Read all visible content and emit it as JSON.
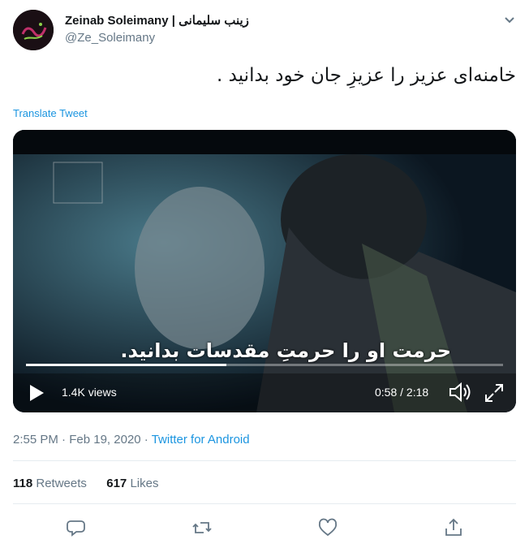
{
  "author": {
    "name": "Zeinab Soleimany | زینب سلیمانی",
    "handle": "@Ze_Soleimany"
  },
  "tweet": {
    "text": "خامنه‌ای عزیز را عزیزِ جان خود بدانید .",
    "translate_label": "Translate Tweet"
  },
  "video": {
    "subtitle": "حرمت او را حرمتِ مقدسات بدانید.",
    "views": "1.4K views",
    "time": "0:58 / 2:18",
    "progress": 0.42
  },
  "meta": {
    "time": "2:55 PM",
    "separator": "·",
    "date": "Feb 19, 2020",
    "source": "Twitter for Android"
  },
  "stats": {
    "retweets_count": "118",
    "retweets_label": "Retweets",
    "likes_count": "617",
    "likes_label": "Likes"
  },
  "colors": {
    "link": "#1b95e0",
    "secondary_text": "#657786",
    "primary_text": "#14171a",
    "divider": "#e6ecf0"
  },
  "icons": [
    "chevron-down-icon",
    "play-icon",
    "volume-icon",
    "fullscreen-icon",
    "reply-icon",
    "retweet-icon",
    "like-icon",
    "share-icon"
  ]
}
